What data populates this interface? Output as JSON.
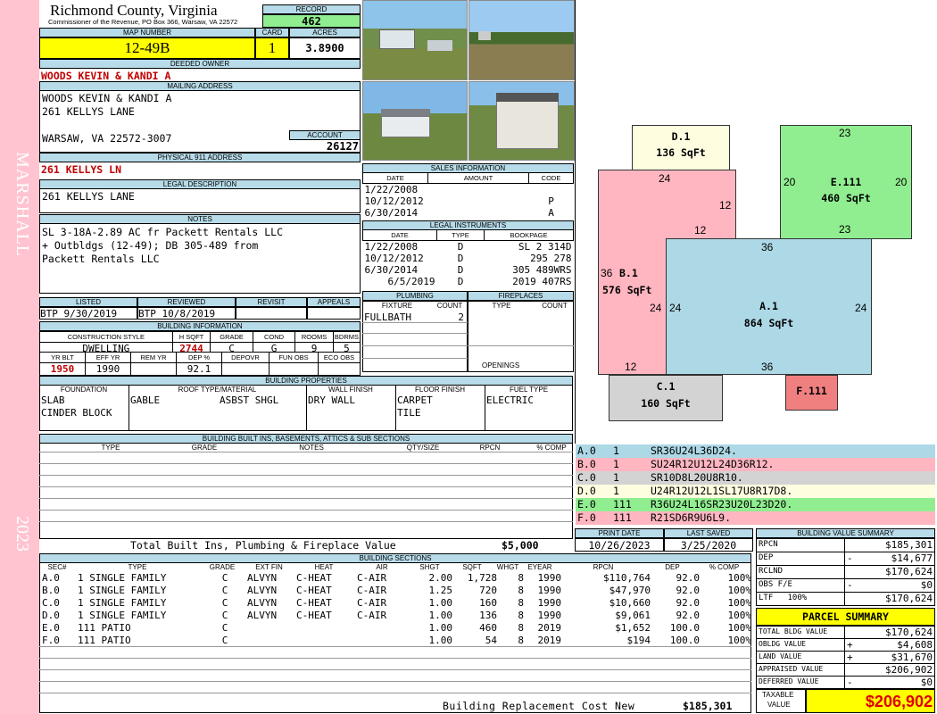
{
  "side": {
    "district": "MARSHALL",
    "year": "2023"
  },
  "header": {
    "county": "Richmond County, Virginia",
    "address": "Commissioner of the Revenue, PO Box 366, Warsaw, VA 22572",
    "record_label": "RECORD",
    "record": "462",
    "map_label": "MAP NUMBER",
    "map": "12-49B",
    "card_label": "CARD",
    "card": "1",
    "acres_label": "ACRES",
    "acres": "3.8900"
  },
  "owner": {
    "label": "DEEDED OWNER",
    "name": "WOODS KEVIN & KANDI A"
  },
  "mailing": {
    "label": "MAILING ADDRESS",
    "line1": "WOODS KEVIN & KANDI A",
    "line2": "261 KELLYS LANE",
    "line3": "WARSAW, VA 22572-3007",
    "account_label": "ACCOUNT",
    "account": "26127"
  },
  "physical": {
    "label": "PHYSICAL 911 ADDRESS",
    "value": "261 KELLYS LN"
  },
  "legal": {
    "label": "LEGAL DESCRIPTION",
    "value": "261 KELLYS LANE"
  },
  "notes": {
    "label": "NOTES",
    "line1": "SL 3-18A-2.89 AC fr Packett Rentals LLC",
    "line2": "+ Outbldgs (12-49); DB 305-489 from",
    "line3": "Packett Rentals LLC"
  },
  "sales": {
    "label": "SALES INFORMATION",
    "cols": [
      "DATE",
      "AMOUNT",
      "CODE"
    ],
    "rows": [
      [
        "1/22/2008",
        "",
        ""
      ],
      [
        "10/12/2012",
        "",
        "P"
      ],
      [
        "6/30/2014",
        "",
        "A"
      ]
    ]
  },
  "instruments": {
    "label": "LEGAL INSTRUMENTS",
    "cols": [
      "DATE",
      "TYPE",
      "BOOKPAGE"
    ],
    "rows": [
      [
        "1/22/2008",
        "D",
        "SL 2 314D"
      ],
      [
        "10/12/2012",
        "D",
        "295 278"
      ],
      [
        "6/30/2014",
        "D",
        "305 489WRS"
      ],
      [
        "6/5/2019",
        "D",
        "2019 407RS"
      ]
    ]
  },
  "plumbing": {
    "label": "PLUMBING",
    "cols": [
      "FIXTURE",
      "COUNT"
    ],
    "rows": [
      [
        "FULLBATH",
        "2"
      ]
    ]
  },
  "fireplaces": {
    "label": "FIREPLACES",
    "cols": [
      "TYPE",
      "COUNT"
    ],
    "openings": "OPENINGS"
  },
  "review": {
    "listed_label": "LISTED",
    "listed": "BTP  9/30/2019",
    "reviewed_label": "REVIEWED",
    "reviewed": "BTP  10/8/2019",
    "revisit_label": "REVISIT",
    "appeals_label": "APPEALS"
  },
  "building_info": {
    "label": "BUILDING INFORMATION",
    "cols1": [
      "CONSTRUCTION STYLE",
      "H SQFT",
      "GRADE",
      "COND",
      "ROOMS",
      "BDRMS"
    ],
    "vals1": [
      "DWELLING",
      "2744",
      "C",
      "G",
      "9",
      "5"
    ],
    "cols2": [
      "YR BLT",
      "EFF YR",
      "REM YR",
      "DEP %",
      "DEPOVR",
      "FUN OBS",
      "ECO OBS"
    ],
    "vals2": [
      "1950",
      "1990",
      "",
      "92.1",
      "",
      "",
      ""
    ]
  },
  "properties": {
    "label": "BUILDING PROPERTIES",
    "cols": [
      "FOUNDATION",
      "ROOF TYPE/MATERIAL",
      "WALL FINISH",
      "FLOOR FINISH",
      "FUEL TYPE"
    ],
    "foundation": [
      "SLAB",
      "CINDER BLOCK"
    ],
    "roof_type": "GABLE",
    "roof_mat": "ASBST SHGL",
    "wall": "DRY WALL",
    "floor": [
      "CARPET",
      "TILE"
    ],
    "fuel": "ELECTRIC"
  },
  "builtins": {
    "label": "BUILDING BUILT INS, BASEMENTS, ATTICS & SUB SECTIONS",
    "cols": [
      "TYPE",
      "GRADE",
      "NOTES",
      "QTY/SIZE",
      "RPCN",
      "% COMP"
    ],
    "total_label": "Total Built Ins, Plumbing & Fireplace Value",
    "total": "$5,000"
  },
  "sections": {
    "label": "BUILDING SECTIONS",
    "cols": [
      "SEC#",
      "TYPE",
      "GRADE",
      "EXT FIN",
      "HEAT",
      "AIR",
      "SHGT",
      "SQFT",
      "WHGT",
      "EYEAR",
      "RPCN",
      "DEP",
      "% COMP"
    ],
    "rows": [
      [
        "A.0",
        "1 SINGLE FAMILY",
        "C",
        "ALVYN",
        "C-HEAT",
        "C-AIR",
        "2.00",
        "1,728",
        "8",
        "1990",
        "$110,764",
        "92.0",
        "100%"
      ],
      [
        "B.0",
        "1 SINGLE FAMILY",
        "C",
        "ALVYN",
        "C-HEAT",
        "C-AIR",
        "1.25",
        "720",
        "8",
        "1990",
        "$47,970",
        "92.0",
        "100%"
      ],
      [
        "C.0",
        "1 SINGLE FAMILY",
        "C",
        "ALVYN",
        "C-HEAT",
        "C-AIR",
        "1.00",
        "160",
        "8",
        "1990",
        "$10,660",
        "92.0",
        "100%"
      ],
      [
        "D.0",
        "1 SINGLE FAMILY",
        "C",
        "ALVYN",
        "C-HEAT",
        "C-AIR",
        "1.00",
        "136",
        "8",
        "1990",
        "$9,061",
        "92.0",
        "100%"
      ],
      [
        "E.0",
        "111 PATIO",
        "C",
        "",
        "",
        "",
        "1.00",
        "460",
        "8",
        "2019",
        "$1,652",
        "100.0",
        "100%"
      ],
      [
        "F.0",
        "111 PATIO",
        "C",
        "",
        "",
        "",
        "1.00",
        "54",
        "8",
        "2019",
        "$194",
        "100.0",
        "100%"
      ]
    ],
    "brc_label": "Building Replacement Cost New",
    "brc": "$185,301"
  },
  "sketch": {
    "A": {
      "label": "A.1",
      "area": "864 SqFt",
      "top": "36",
      "bottom": "36",
      "left": "24",
      "right": "24"
    },
    "B": {
      "label": "B.1",
      "area": "576 SqFt",
      "top": "24",
      "left": "36",
      "r1": "12",
      "r2": "12",
      "inner": "24",
      "bottom": "12"
    },
    "C": {
      "label": "C.1",
      "area": "160 SqFt"
    },
    "D": {
      "label": "D.1",
      "area": "136 SqFt"
    },
    "E": {
      "label": "E.111",
      "area": "460 SqFt",
      "top": "23",
      "bottom": "23",
      "left": "20",
      "right": "20"
    },
    "F": {
      "label": "F.111"
    }
  },
  "vectors": [
    {
      "sec": "A.0",
      "n": "1",
      "v": "SR36U24L36D24.",
      "c": "#add8e6"
    },
    {
      "sec": "B.0",
      "n": "1",
      "v": "SU24R12U12L24D36R12.",
      "c": "#ffb6c1"
    },
    {
      "sec": "C.0",
      "n": "1",
      "v": "SR10D8L20U8R10.",
      "c": "#d3d3d3"
    },
    {
      "sec": "D.0",
      "n": "1",
      "v": "U24R12U12L1SL17U8R17D8.",
      "c": "#fffde0"
    },
    {
      "sec": "E.0",
      "n": "111",
      "v": "R36U24L16SR23U20L23D20.",
      "c": "#90ee90"
    },
    {
      "sec": "F.0",
      "n": "111",
      "v": "R21SD6R9U6L9.",
      "c": "#ffb6c1"
    }
  ],
  "print": {
    "print_label": "PRINT DATE",
    "print": "10/26/2023",
    "saved_label": "LAST SAVED",
    "saved": "3/25/2020"
  },
  "value_summary": {
    "label": "BUILDING VALUE SUMMARY",
    "rows": [
      [
        "RPCN",
        "",
        "$185,301"
      ],
      [
        "DEP",
        "-",
        "$14,677"
      ],
      [
        "RCLND",
        "",
        "$170,624"
      ],
      [
        "OBS F/E",
        "-",
        "$0"
      ],
      [
        "LTF   100%",
        "",
        "$170,624"
      ]
    ]
  },
  "parcel": {
    "label": "PARCEL SUMMARY",
    "rows": [
      [
        "TOTAL BLDG VALUE",
        "",
        "$170,624"
      ],
      [
        "OBLDG VALUE",
        "+",
        "$4,608"
      ],
      [
        "LAND VALUE",
        "+",
        "$31,670"
      ],
      [
        "APPRAISED VALUE",
        "",
        "$206,902"
      ],
      [
        "DEFERRED VALUE",
        "-",
        "$0"
      ]
    ],
    "taxable_label1": "TAXABLE",
    "taxable_label2": "VALUE",
    "taxable": "$206,902"
  },
  "colors": {
    "header_blue": "#b7dbe8",
    "record_green": "#90ee90",
    "map_yellow": "#ffff00",
    "side_pink": "#ffc0cb"
  }
}
